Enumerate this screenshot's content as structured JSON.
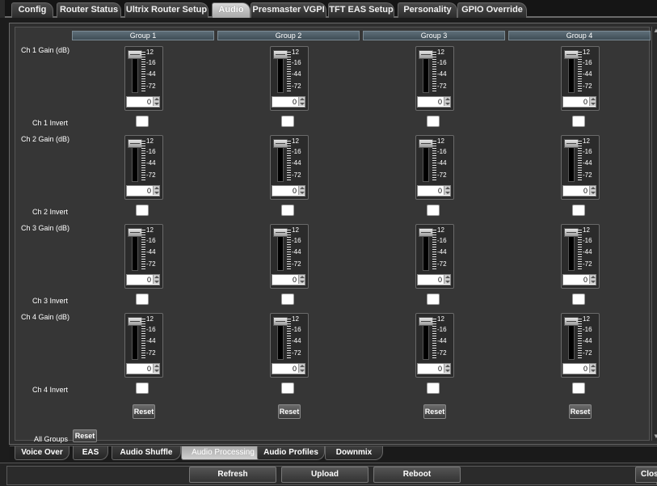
{
  "top_tabs": [
    {
      "label": "Config",
      "active": false
    },
    {
      "label": "Router Status",
      "active": false
    },
    {
      "label": "Ultrix Router Setup",
      "active": false
    },
    {
      "label": "Audio",
      "active": true
    },
    {
      "label": "Presmaster VGPI",
      "active": false
    },
    {
      "label": "TFT EAS Setup",
      "active": false
    },
    {
      "label": "Personality",
      "active": false
    },
    {
      "label": "GPIO Override",
      "active": false
    }
  ],
  "groups": [
    "Group 1",
    "Group 2",
    "Group 3",
    "Group 4"
  ],
  "channels": [
    {
      "gain_label": "Ch 1 Gain (dB)",
      "invert_label": "Ch 1 Invert"
    },
    {
      "gain_label": "Ch 2 Gain (dB)",
      "invert_label": "Ch 2 Invert"
    },
    {
      "gain_label": "Ch 3 Gain (dB)",
      "invert_label": "Ch 3 Invert"
    },
    {
      "gain_label": "Ch 4 Gain (dB)",
      "invert_label": "Ch 4 Invert"
    }
  ],
  "fader_scale": [
    "12",
    "-16",
    "-44",
    "-72"
  ],
  "gain_values": [
    [
      "0",
      "0",
      "0",
      "0"
    ],
    [
      "0",
      "0",
      "0",
      "0"
    ],
    [
      "0",
      "0",
      "0",
      "0"
    ],
    [
      "0",
      "0",
      "0",
      "0"
    ]
  ],
  "reset_label": "Reset",
  "all_groups_label": "All Groups",
  "all_groups_reset_label": "Reset",
  "bottom_tabs": [
    {
      "label": "Voice Over",
      "active": false
    },
    {
      "label": "EAS",
      "active": false
    },
    {
      "label": "Audio Shuffle",
      "active": false
    },
    {
      "label": "Audio Processing",
      "active": true
    },
    {
      "label": "Audio Profiles",
      "active": false
    },
    {
      "label": "Downmix",
      "active": false
    }
  ],
  "footer": {
    "refresh_label": "Refresh",
    "upload_label": "Upload",
    "reboot_label": "Reboot",
    "close_label": "Close"
  }
}
